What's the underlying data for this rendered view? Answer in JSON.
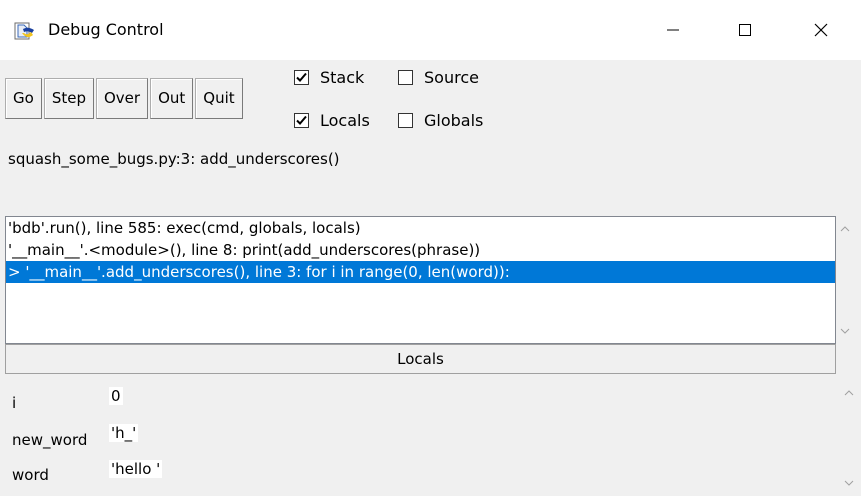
{
  "window": {
    "title": "Debug Control",
    "minimize_icon": "minimize-icon",
    "maximize_icon": "maximize-icon",
    "close_icon": "close-icon"
  },
  "toolbar": {
    "buttons": [
      "Go",
      "Step",
      "Over",
      "Out",
      "Quit"
    ]
  },
  "options": {
    "stack": {
      "label": "Stack",
      "checked": true
    },
    "source": {
      "label": "Source",
      "checked": false
    },
    "locals": {
      "label": "Locals",
      "checked": true
    },
    "globals": {
      "label": "Globals",
      "checked": false
    }
  },
  "status": "squash_some_bugs.py:3: add_underscores()",
  "stack": {
    "rows": [
      "'bdb'.run(), line 585: exec(cmd, globals, locals)",
      "'__main__'.<module>(), line 8: print(add_underscores(phrase))",
      "> '__main__'.add_underscores(), line 3: for i in range(0, len(word)):"
    ],
    "selected_index": 2
  },
  "locals": {
    "header": "Locals",
    "vars": [
      {
        "name": "i",
        "value": "0"
      },
      {
        "name": "new_word",
        "value": "'h_'"
      },
      {
        "name": "word",
        "value": "'hello '"
      }
    ]
  },
  "colors": {
    "selection": "#0078d7",
    "client_bg": "#f0f0f0"
  }
}
